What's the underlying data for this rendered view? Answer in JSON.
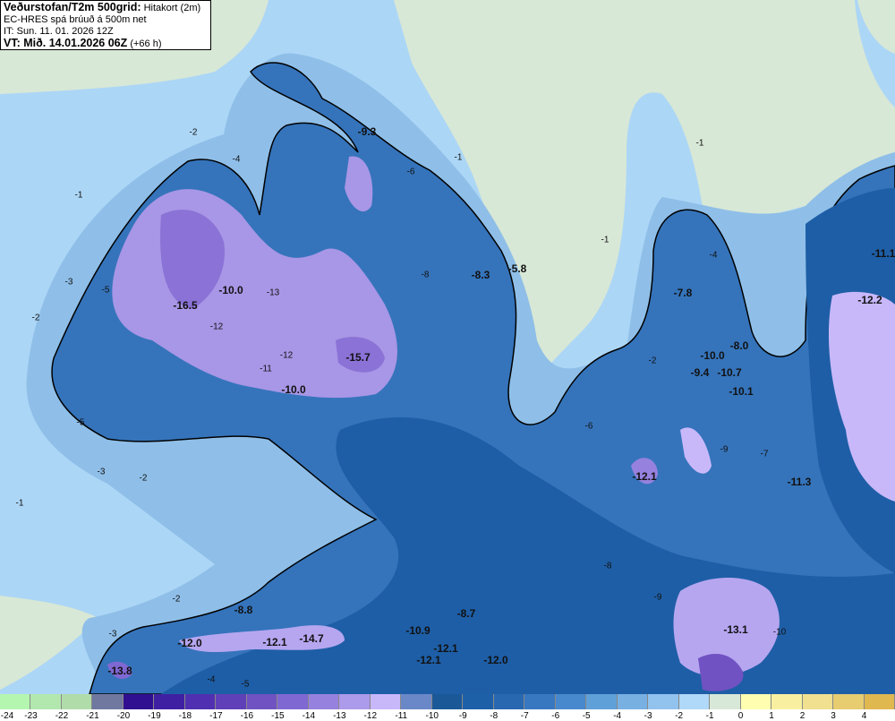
{
  "header": {
    "title_bold": "Veðurstofan/T2m 500grid:",
    "title_rest": "Hitakort (2m)",
    "line2": "EC-HRES spá brúuð á 500m net",
    "line3": "IT: Sun. 11. 01. 2026 12Z",
    "line4_bold": "VT: Mið. 14.01.2026 06Z",
    "line4_rest": "(+66 h)"
  },
  "colors": {
    "ocean": "#acd6f6",
    "ice_free_land": "#d8e8d6",
    "land_base": "#2a68ae",
    "coastline": "#000000"
  },
  "map": {
    "bold_labels": [
      "-9.3",
      "-8.3",
      "-5.8",
      "-10.0",
      "-16.5",
      "-15.7",
      "-10.0",
      "-7.8",
      "-8.0",
      "-10.0",
      "-9.4",
      "-10.7",
      "-10.1",
      "-11.1",
      "-12.2",
      "-12.1",
      "-11.3",
      "-8.8",
      "-12.0",
      "-12.1",
      "-14.7",
      "-10.9",
      "-12.1",
      "-12.1",
      "-12.0",
      "-8.7",
      "-13.8",
      "-13.1"
    ],
    "contour_labels": [
      "-1",
      "-2",
      "-3",
      "-4",
      "-5",
      "-1",
      "-2",
      "-3",
      "-5",
      "-1",
      "-1",
      "-2",
      "-2",
      "-4",
      "-6",
      "-8",
      "-12",
      "-13",
      "-12",
      "-11",
      "-9",
      "-10",
      "-9",
      "-8",
      "-7",
      "-6",
      "-1",
      "-2",
      "-3",
      "-4",
      "-5"
    ]
  },
  "legend": {
    "values": [
      "-24",
      "-23",
      "-22",
      "-21",
      "-20",
      "-19",
      "-18",
      "-17",
      "-16",
      "-15",
      "-14",
      "-13",
      "-12",
      "-11",
      "-10",
      "-9",
      "-8",
      "-7",
      "-6",
      "-5",
      "-4",
      "-3",
      "-2",
      "-1",
      "0",
      "1",
      "2",
      "3",
      "4"
    ],
    "colors": [
      "#b4f6b0",
      "#b2e8ae",
      "#b0dcaa",
      "#7078a0",
      "#301090",
      "#4020a2",
      "#5030b0",
      "#6040b8",
      "#7052c2",
      "#8068d2",
      "#9682de",
      "#ac9aea",
      "#c8b8fa",
      "#6a88c8",
      "#1a5898",
      "#1e60a8",
      "#2868b0",
      "#3878c0",
      "#4888cc",
      "#60a0d8",
      "#78b0e2",
      "#92c2ee",
      "#b0d8f8",
      "#d8e8d8",
      "#fffeb0",
      "#f8f0a0",
      "#f0e090",
      "#e8cc70",
      "#e0b850"
    ]
  }
}
